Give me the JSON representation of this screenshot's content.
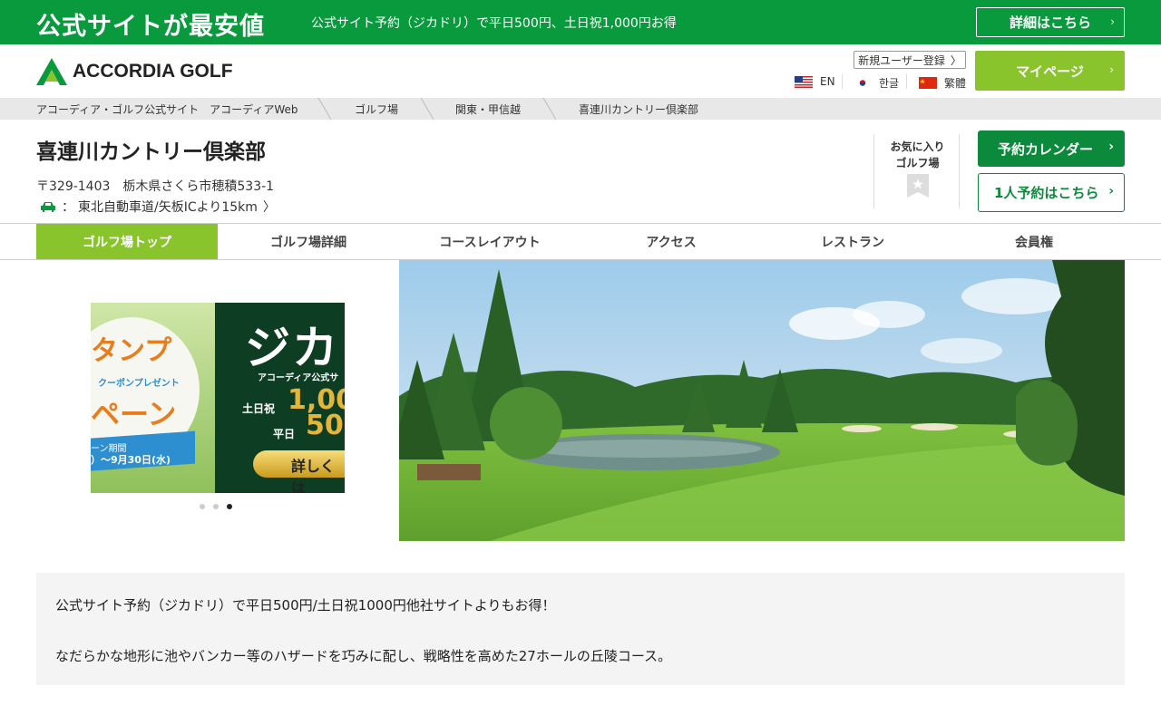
{
  "promo": {
    "title": "公式サイトが最安値",
    "text": "公式サイト予約（ジカドリ）で平日500円、土日祝1,000円お得",
    "button": "詳細はこちら"
  },
  "header": {
    "logo_text": "ACCORDIA GOLF",
    "register": "新規ユーザー登録",
    "languages": [
      "EN",
      "한글",
      "繁體"
    ],
    "mypage": "マイページ"
  },
  "breadcrumb": [
    "アコーディア・ゴルフ公式サイト　アコーディアWeb",
    "ゴルフ場",
    "関東・甲信越",
    "喜連川カントリー倶楽部"
  ],
  "course": {
    "name": "喜連川カントリー倶楽部",
    "address": "〒329-1403　栃木県さくら市穂積533-1",
    "access_sep": "：",
    "access": "東北自動車道/矢板ICより15km"
  },
  "favorite": {
    "line1": "お気に入り",
    "line2": "ゴルフ場"
  },
  "actions": {
    "calendar": "予約カレンダー",
    "solo": "1人予約はこちら"
  },
  "tabs": [
    "ゴルフ場トップ",
    "ゴルフ場詳細",
    "コースレイアウト",
    "アクセス",
    "レストラン",
    "会員権"
  ],
  "banner": {
    "left": {
      "t1": "タンプ",
      "t2": "クーポンプレゼント",
      "t3": "ペーン",
      "t4": "ーン期間",
      "t5": "）～9月30日(水)"
    },
    "right": {
      "t1": "ジカ",
      "t2": "アコーディア公式サ",
      "t3": "土日祝",
      "t4": "1,00",
      "t5": "平日",
      "t6": "50",
      "t7": "詳しくは"
    },
    "slide_count": 3,
    "current_slide": 3
  },
  "description": {
    "p1": "公式サイト予約（ジカドリ）で平日500円/土日祝1000円他社サイトよりもお得！",
    "p2": "なだらかな地形に池やバンカー等のハザードを巧みに配し、戦略性を高めた27ホールの丘陵コース。"
  },
  "colors": {
    "brand_green": "#0a9a3e",
    "accent_lime": "#8ac42c",
    "button_green": "#0a8a3a"
  }
}
